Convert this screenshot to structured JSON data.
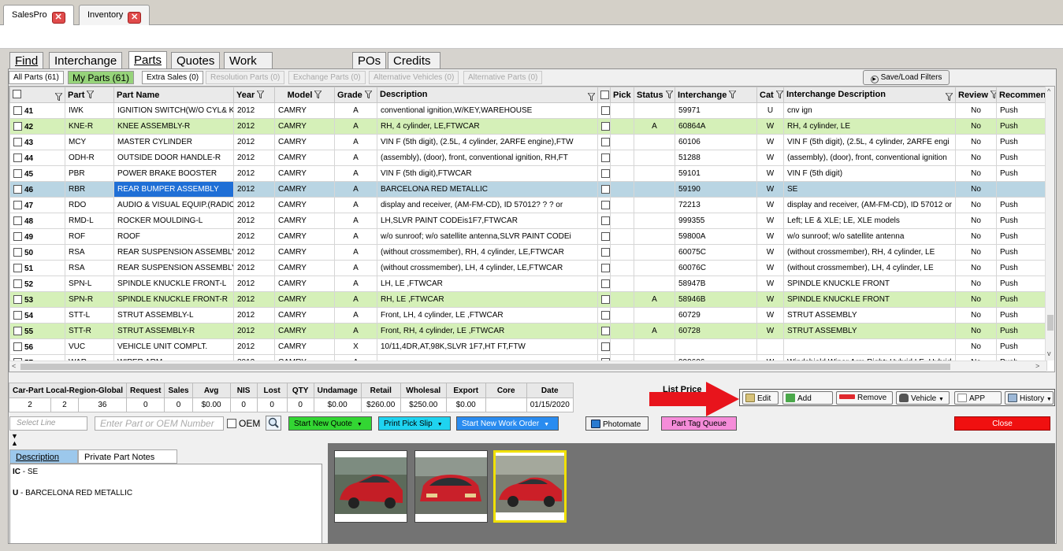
{
  "app_tabs": [
    {
      "label": "SalesPro"
    },
    {
      "label": "Inventory"
    }
  ],
  "module_tabs": [
    "Find",
    "Interchange",
    "Parts",
    "Quotes",
    "Work Order / Invoice",
    "POs",
    "Credits / Returns"
  ],
  "sub_tabs": [
    "All Parts (61)",
    "My Parts (61)",
    "Extra Sales (0)",
    "Resolution Parts (0)",
    "Exchange Parts (0)",
    "Alternative Vehicles (0)",
    "Alternative Parts (0)"
  ],
  "save_filters": "Save/Load Filters",
  "grid": {
    "headers": [
      "",
      "Part",
      "Part Name",
      "Year",
      "Model",
      "Grade",
      "Description",
      "",
      "Pick",
      "Status",
      "Interchange",
      "Cat",
      "Interchange Description",
      "Review",
      "Recommend"
    ],
    "rows": [
      {
        "num": "41",
        "part": "IWK",
        "name": "IGNITION SWITCH(W/O CYL& KE",
        "year": "2012",
        "model": "CAMRY",
        "grade": "A",
        "desc": "conventional ignition,W/KEY,WAREHOUSE",
        "status": "",
        "inter": "59971",
        "cat": "U",
        "idesc": "cnv ign",
        "review": "No",
        "rec": "Push",
        "style": ""
      },
      {
        "num": "42",
        "part": "KNE-R",
        "name": "KNEE ASSEMBLY-R",
        "year": "2012",
        "model": "CAMRY",
        "grade": "A",
        "desc": "RH, 4 cylinder, LE,FTWCAR",
        "status": "A",
        "inter": "60864A",
        "cat": "W",
        "idesc": "RH, 4 cylinder, LE",
        "review": "No",
        "rec": "Push",
        "style": "green"
      },
      {
        "num": "43",
        "part": "MCY",
        "name": "MASTER CYLINDER",
        "year": "2012",
        "model": "CAMRY",
        "grade": "A",
        "desc": "VIN F (5th digit), (2.5L, 4 cylinder, 2ARFE engine),FTW",
        "status": "",
        "inter": "60106",
        "cat": "W",
        "idesc": "VIN F (5th digit), (2.5L, 4 cylinder, 2ARFE engi",
        "review": "No",
        "rec": "Push",
        "style": ""
      },
      {
        "num": "44",
        "part": "ODH-R",
        "name": "OUTSIDE DOOR HANDLE-R",
        "year": "2012",
        "model": "CAMRY",
        "grade": "A",
        "desc": "(assembly), (door), front, conventional ignition, RH,FT",
        "status": "",
        "inter": "51288",
        "cat": "W",
        "idesc": "(assembly), (door), front, conventional ignition",
        "review": "No",
        "rec": "Push",
        "style": ""
      },
      {
        "num": "45",
        "part": "PBR",
        "name": "POWER BRAKE BOOSTER",
        "year": "2012",
        "model": "CAMRY",
        "grade": "A",
        "desc": "VIN F (5th digit),FTWCAR",
        "status": "",
        "inter": "59101",
        "cat": "W",
        "idesc": "VIN F (5th digit)",
        "review": "No",
        "rec": "Push",
        "style": ""
      },
      {
        "num": "46",
        "part": "RBR",
        "name": "REAR BUMPER ASSEMBLY",
        "year": "2012",
        "model": "CAMRY",
        "grade": "A",
        "desc": "BARCELONA RED METALLIC",
        "status": "",
        "inter": "59190",
        "cat": "W",
        "idesc": "SE",
        "review": "No",
        "rec": "",
        "style": "sel"
      },
      {
        "num": "47",
        "part": "RDO",
        "name": "AUDIO & VISUAL EQUIP.(RADIO",
        "year": "2012",
        "model": "CAMRY",
        "grade": "A",
        "desc": "display and receiver, (AM-FM-CD), ID 57012? ? ? or",
        "status": "",
        "inter": "72213",
        "cat": "W",
        "idesc": "display and receiver, (AM-FM-CD), ID 57012 or",
        "review": "No",
        "rec": "Push",
        "style": ""
      },
      {
        "num": "48",
        "part": "RMD-L",
        "name": "ROCKER MOULDING-L",
        "year": "2012",
        "model": "CAMRY",
        "grade": "A",
        "desc": "LH,SLVR PAINT CODEis1F7,FTWCAR",
        "status": "",
        "inter": "999355",
        "cat": "W",
        "idesc": "Left; LE & XLE; LE, XLE models",
        "review": "No",
        "rec": "Push",
        "style": ""
      },
      {
        "num": "49",
        "part": "ROF",
        "name": "ROOF",
        "year": "2012",
        "model": "CAMRY",
        "grade": "A",
        "desc": "w/o sunroof; w/o satellite antenna,SLVR PAINT CODEi",
        "status": "",
        "inter": "59800A",
        "cat": "W",
        "idesc": "w/o sunroof; w/o satellite antenna",
        "review": "No",
        "rec": "Push",
        "style": ""
      },
      {
        "num": "50",
        "part": "RSA",
        "name": "REAR SUSPENSION ASSEMBLY",
        "year": "2012",
        "model": "CAMRY",
        "grade": "A",
        "desc": "(without crossmember), RH, 4 cylinder, LE,FTWCAR",
        "status": "",
        "inter": "60075C",
        "cat": "W",
        "idesc": "(without crossmember), RH, 4 cylinder, LE",
        "review": "No",
        "rec": "Push",
        "style": ""
      },
      {
        "num": "51",
        "part": "RSA",
        "name": "REAR SUSPENSION ASSEMBLY",
        "year": "2012",
        "model": "CAMRY",
        "grade": "A",
        "desc": "(without crossmember), LH, 4 cylinder, LE,FTWCAR",
        "status": "",
        "inter": "60076C",
        "cat": "W",
        "idesc": "(without crossmember), LH, 4 cylinder, LE",
        "review": "No",
        "rec": "Push",
        "style": ""
      },
      {
        "num": "52",
        "part": "SPN-L",
        "name": "SPINDLE KNUCKLE FRONT-L",
        "year": "2012",
        "model": "CAMRY",
        "grade": "A",
        "desc": "LH, LE ,FTWCAR",
        "status": "",
        "inter": "58947B",
        "cat": "W",
        "idesc": "SPINDLE KNUCKLE FRONT",
        "review": "No",
        "rec": "Push",
        "style": ""
      },
      {
        "num": "53",
        "part": "SPN-R",
        "name": "SPINDLE KNUCKLE FRONT-R",
        "year": "2012",
        "model": "CAMRY",
        "grade": "A",
        "desc": "RH, LE ,FTWCAR",
        "status": "A",
        "inter": "58946B",
        "cat": "W",
        "idesc": "SPINDLE KNUCKLE FRONT",
        "review": "No",
        "rec": "Push",
        "style": "green"
      },
      {
        "num": "54",
        "part": "STT-L",
        "name": "STRUT ASSEMBLY-L",
        "year": "2012",
        "model": "CAMRY",
        "grade": "A",
        "desc": "Front, LH, 4 cylinder, LE ,FTWCAR",
        "status": "",
        "inter": "60729",
        "cat": "W",
        "idesc": "STRUT ASSEMBLY",
        "review": "No",
        "rec": "Push",
        "style": ""
      },
      {
        "num": "55",
        "part": "STT-R",
        "name": "STRUT ASSEMBLY-R",
        "year": "2012",
        "model": "CAMRY",
        "grade": "A",
        "desc": "Front, RH, 4 cylinder, LE ,FTWCAR",
        "status": "A",
        "inter": "60728",
        "cat": "W",
        "idesc": "STRUT ASSEMBLY",
        "review": "No",
        "rec": "Push",
        "style": "green"
      },
      {
        "num": "56",
        "part": "VUC",
        "name": "VEHICLE UNIT COMPLT.",
        "year": "2012",
        "model": "CAMRY",
        "grade": "X",
        "desc": "10/11,4DR,AT,98K,SLVR 1F7,HT FT,FTW",
        "status": "",
        "inter": "",
        "cat": "",
        "idesc": "",
        "review": "No",
        "rec": "Push",
        "style": ""
      },
      {
        "num": "57",
        "part": "WAR",
        "name": "WIPER ARM",
        "year": "2012",
        "model": "CAMRY",
        "grade": "A",
        "desc": "",
        "status": "",
        "inter": "999606",
        "cat": "W",
        "idesc": "Windshield Wiper Arm Right; Hybrid LE, Hybrid",
        "review": "No",
        "rec": "Push",
        "style": ""
      }
    ]
  },
  "stats": {
    "headers": [
      "Car-Part Local-Region-Global",
      "Request",
      "Sales",
      "Avg",
      "NIS",
      "Lost",
      "QTY",
      "Undamage",
      "Retail",
      "Wholesal",
      "Export",
      "Core",
      "Date"
    ],
    "values": [
      "2",
      "2",
      "36",
      "0",
      "0",
      "$0.00",
      "0",
      "0",
      "0",
      "$0.00",
      "$260.00",
      "$250.00",
      "$0.00",
      "",
      "01/15/2020"
    ],
    "list_price": "List Price"
  },
  "actions": [
    "Edit",
    "Add",
    "Remove",
    "Vehicle",
    "APP",
    "History"
  ],
  "inputs": {
    "select_line": "Select Line",
    "part_placeholder": "Enter Part or OEM Number",
    "oem_label": "OEM"
  },
  "buttons": {
    "start_quote": "Start New Quote",
    "print_pick": "Print Pick Slip",
    "start_wo": "Start New Work Order",
    "photomate": "Photomate",
    "tag_queue": "Part Tag Queue",
    "close": "Close"
  },
  "desc_tabs": [
    "Description",
    "Private Part Notes"
  ],
  "description": {
    "ic_label": "IC",
    "ic_value": "SE",
    "u_label": "U",
    "u_value": "BARCELONA RED METALLIC"
  },
  "colors": {
    "green_row": "#d5f0b8",
    "selected_row": "#b9d5e3",
    "highlight": "#1f6fd6",
    "arrow": "#e8141c"
  }
}
